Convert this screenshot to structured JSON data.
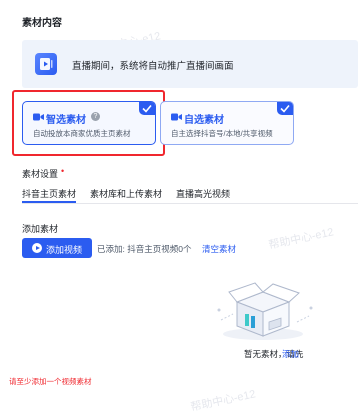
{
  "section_title": "素材内容",
  "banner": {
    "text": "直播期间，系统将自动推广直播间画面",
    "icon": "live-screen-icon"
  },
  "cards": [
    {
      "title": "智选素材",
      "subtitle": "自动投放本商家优质主页素材",
      "selected": true,
      "icon": "video-camera-icon",
      "has_help": true,
      "help_glyph": "?"
    },
    {
      "title": "自选素材",
      "subtitle": "自主选择抖音号/本地/共享视频",
      "selected": true,
      "icon": "video-camera-icon",
      "has_help": false
    }
  ],
  "settings": {
    "label": "素材设置",
    "required_mark": "•"
  },
  "tabs": [
    {
      "label": "抖音主页素材",
      "active": true
    },
    {
      "label": "素材库和上传素材",
      "active": false
    },
    {
      "label": "直播高光视频",
      "active": false
    }
  ],
  "add_material": {
    "label": "添加素材",
    "button_label": "添加视频",
    "added_text": "已添加: 抖音主页视频0个",
    "clear_link": "清空素材"
  },
  "empty_state": {
    "text": "暂无素材，请先",
    "link": "添加"
  },
  "error_text": "请至少添加一个视频素材",
  "watermarks": [
    "帮助中心-e12",
    "帮助中心-e12",
    "帮助中心-e12"
  ],
  "colors": {
    "primary": "#2b5cf0",
    "error": "#f0272e",
    "banner_bg": "#eef3fb"
  }
}
